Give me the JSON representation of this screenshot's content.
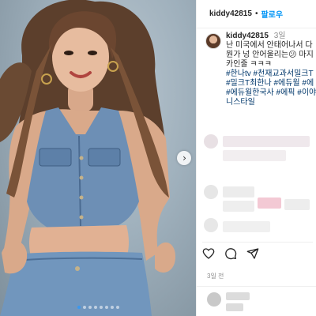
{
  "post": {
    "username": "kiddy42815",
    "follow_label": "팔로우",
    "separator": "•",
    "time_ago": "3일",
    "posted_label": "3일 전",
    "image_alt": "Woman with long wavy brown hair wearing a denim crop vest and denim shorts",
    "carousel": {
      "dot_count": 8,
      "active_index": 0
    }
  },
  "caption": {
    "lines": [
      "난 미국에서 안태어나서 다",
      "뭔가 넝 안어울리는",
      "카인줄 ㅋㅋㅋ"
    ],
    "line2_suffix": " 마지",
    "emoji": "😕",
    "hashtags": [
      "#한나tv #천재교과서밀크T",
      "#밀크T최한나 #에듀윌 #에",
      "#에듀윌한국사 #에픽 #이야",
      "니스타일"
    ]
  },
  "icons": [
    "next-chevron-icon",
    "heart-icon",
    "comment-icon",
    "share-icon"
  ],
  "colors": {
    "accent": "#0095f6",
    "hashtag": "#00376b",
    "muted": "#8e8e8e",
    "active_dot": "#3a98f0"
  }
}
